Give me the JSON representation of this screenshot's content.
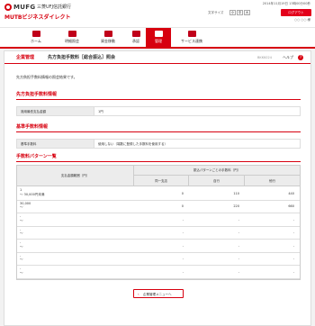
{
  "header": {
    "brand": "MUFG",
    "bank_name": "三菱UFJ信託銀行",
    "service_name": "MUTBビジネスダイレクト",
    "datetime": "2014年11月19日 13時00分00秒",
    "font_size_label": "文字サイズ",
    "font_sizes": [
      "小",
      "中",
      "大"
    ],
    "logout_label": "ログアウト",
    "user_label": "○○ ○○ 様"
  },
  "nav": {
    "items": [
      {
        "label": "ホーム",
        "icon": "home-icon"
      },
      {
        "label": "明細照会",
        "icon": "document-icon"
      },
      {
        "label": "資金移動",
        "icon": "transfer-icon"
      },
      {
        "label": "承認",
        "icon": "approval-icon"
      },
      {
        "label": "管理",
        "icon": "admin-icon",
        "active": true
      },
      {
        "label": "サービス連携",
        "icon": "link-icon"
      }
    ]
  },
  "page": {
    "category": "企業管理",
    "title": "先方負担手数料［総合振込］照会",
    "screen_id": "BKKK024",
    "help_label": "ヘルプ",
    "intro": "先方負担手数料情報の照会結果です。"
  },
  "sections": {
    "fee_info": {
      "title": "先方負担手数料情報",
      "rows": [
        {
          "label": "適用最低支払金額",
          "value": "1円"
        }
      ]
    },
    "base_fee": {
      "title": "基準手数料情報",
      "rows": [
        {
          "label": "基準手数料",
          "value": "使用しない（端数に登録した手数料を使用する）"
        }
      ]
    },
    "pattern_list": {
      "title": "手数料パターン一覧",
      "col_range": "支払金額範囲（円）",
      "col_pattern": "振込パターンごとの手数料（円）",
      "sub_cols": [
        "同一支店",
        "自行",
        "他行"
      ],
      "rows": [
        {
          "range_from": "1",
          "range_to": "～ 30,000円未満",
          "same_branch": "0",
          "own_bank": "110",
          "other_bank": "440"
        },
        {
          "range_from": "30,000",
          "range_to": "～",
          "same_branch": "0",
          "own_bank": "220",
          "other_bank": "660"
        },
        {
          "range_from": "-",
          "range_to": "～",
          "same_branch": "-",
          "own_bank": "-",
          "other_bank": "-"
        },
        {
          "range_from": "-",
          "range_to": "～",
          "same_branch": "-",
          "own_bank": "-",
          "other_bank": "-"
        },
        {
          "range_from": "-",
          "range_to": "～",
          "same_branch": "-",
          "own_bank": "-",
          "other_bank": "-"
        },
        {
          "range_from": "-",
          "range_to": "～",
          "same_branch": "-",
          "own_bank": "-",
          "other_bank": "-"
        },
        {
          "range_from": "-",
          "range_to": "～",
          "same_branch": "-",
          "own_bank": "-",
          "other_bank": "-"
        }
      ]
    }
  },
  "footer": {
    "back_label": "企業管理メニューへ"
  },
  "colors": {
    "brand_red": "#d7000f",
    "logout_red": "#e3001b"
  }
}
